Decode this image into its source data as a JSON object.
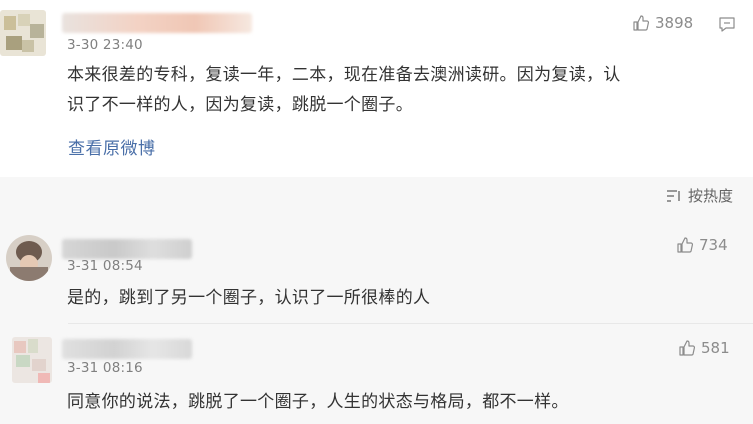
{
  "top_comment": {
    "timestamp": "3-30 23:40",
    "likes": "3898",
    "text_line1": "本来很差的专科，复读一年，二本，现在准备去澳洲读研。因为复读，认",
    "text_line2": "识了不一样的人，因为复读，跳脱一个圈子。",
    "view_original": "查看原微博"
  },
  "sort": {
    "label": "按热度"
  },
  "replies": [
    {
      "timestamp": "3-31 08:54",
      "likes": "734",
      "text": "是的，跳到了另一个圈子，认识了一所很棒的人"
    },
    {
      "timestamp": "3-31 08:16",
      "likes": "581",
      "text": "同意你的说法，跳脱了一个圈子，人生的状态与格局，都不一样。"
    }
  ],
  "colors": {
    "link": "#4a6fa8",
    "band": "#f7f7f7",
    "muted": "#808080"
  }
}
